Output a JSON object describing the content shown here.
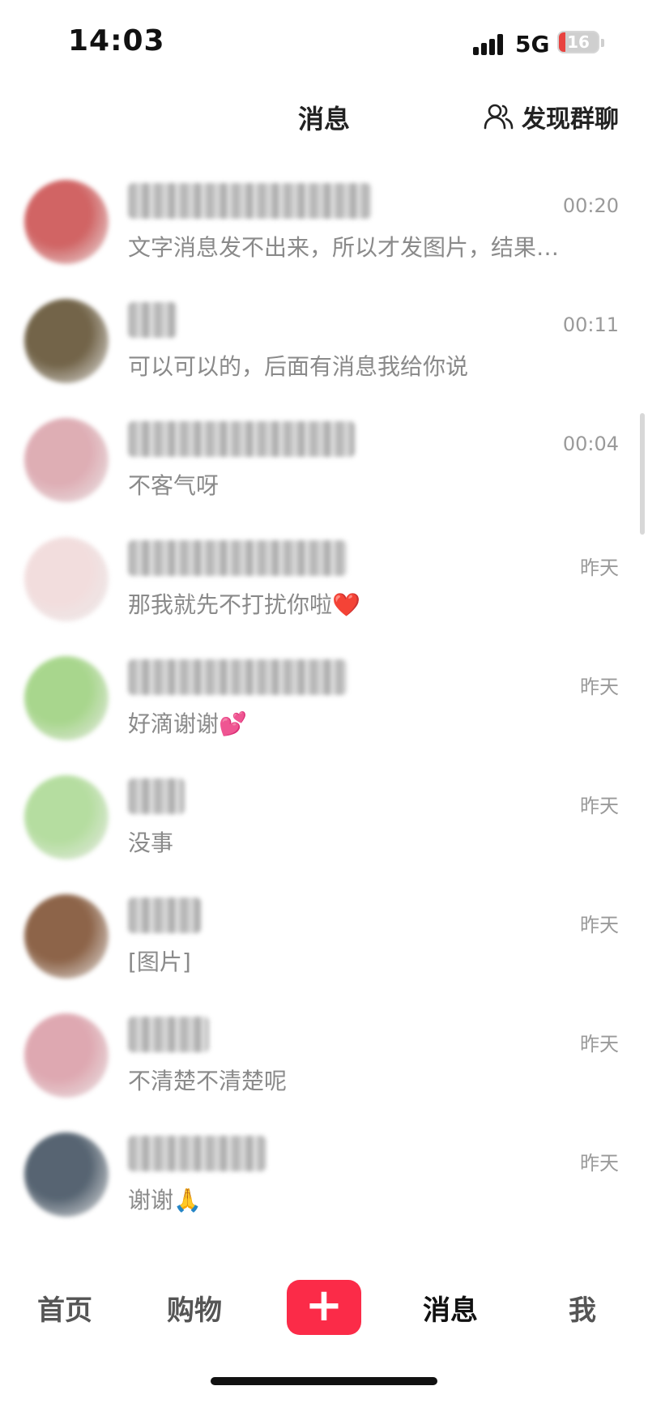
{
  "status_bar": {
    "time": "14:03",
    "network": "5G",
    "battery": "16"
  },
  "header": {
    "title": "消息",
    "discover_label": "发现群聊"
  },
  "chats": [
    {
      "time": "00:20",
      "preview": "文字消息发不出来，所以才发图片，结果…",
      "avatar_color": "#c94a4a"
    },
    {
      "time": "00:11",
      "preview": "可以可以的，后面有消息我给你说",
      "avatar_color": "#5b4a2a"
    },
    {
      "time": "00:04",
      "preview": "不客气呀",
      "avatar_color": "#d9a0a8"
    },
    {
      "time": "昨天",
      "preview": "那我就先不打扰你啦❤️",
      "avatar_color": "#f0d8d8"
    },
    {
      "time": "昨天",
      "preview": "好滴谢谢💕",
      "avatar_color": "#9ad07a"
    },
    {
      "time": "昨天",
      "preview": "没事",
      "avatar_color": "#a9d890"
    },
    {
      "time": "昨天",
      "preview": "[图片]",
      "avatar_color": "#7a4a2a"
    },
    {
      "time": "昨天",
      "preview": "不清楚不清楚呢",
      "avatar_color": "#d99aa4"
    },
    {
      "time": "昨天",
      "preview": "谢谢🙏",
      "avatar_color": "#3a4a5a"
    }
  ],
  "tabs": {
    "home": "首页",
    "shop": "购物",
    "add": "+",
    "messages": "消息",
    "me": "我"
  }
}
